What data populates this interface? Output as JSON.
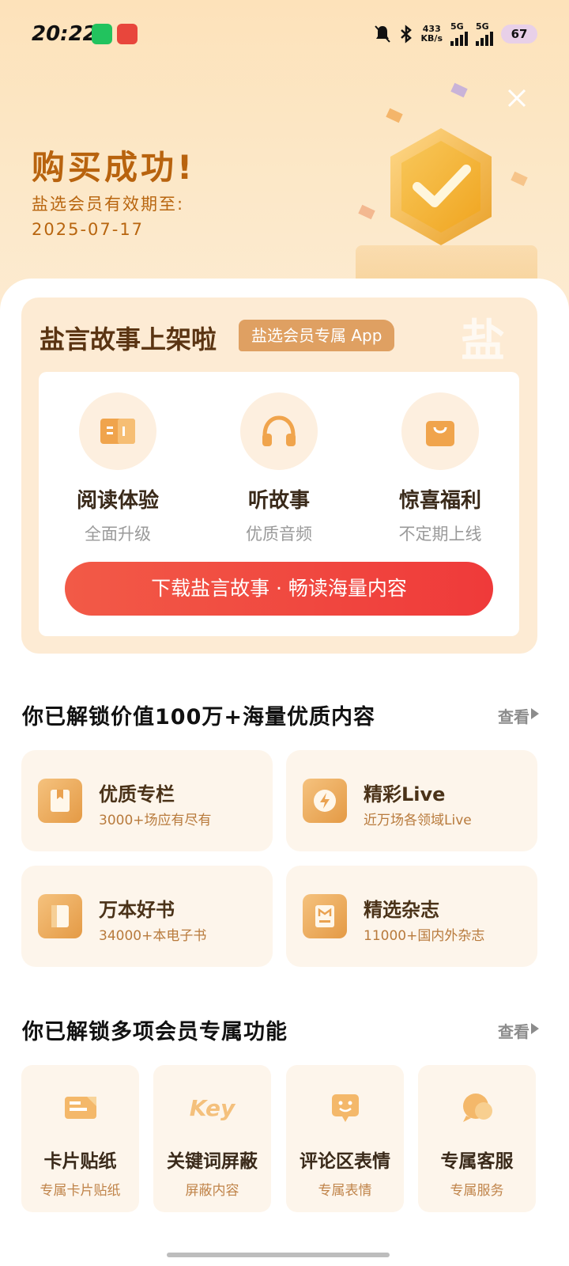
{
  "status_bar": {
    "time": "20:22",
    "net_speed_value": "433",
    "net_speed_unit": "KB/s",
    "sim1": "5G",
    "sim2": "5G",
    "battery": "67"
  },
  "hero": {
    "title": "购买成功!",
    "validity_label": "盐选会员有效期至:",
    "validity_date": "2025-07-17"
  },
  "promo": {
    "title": "盐言故事上架啦",
    "tag": "盐选会员专属 App",
    "watermark": "盐",
    "features": [
      {
        "title": "阅读体验",
        "subtitle": "全面升级",
        "icon": "book-icon"
      },
      {
        "title": "听故事",
        "subtitle": "优质音频",
        "icon": "headphones-icon"
      },
      {
        "title": "惊喜福利",
        "subtitle": "不定期上线",
        "icon": "shopping-bag-icon"
      }
    ],
    "download_button": "下载盐言故事 · 畅读海量内容"
  },
  "content_section": {
    "title": "你已解锁价值100万+海量优质内容",
    "more": "查看",
    "cards": [
      {
        "title": "优质专栏",
        "subtitle": "3000+场应有尽有",
        "icon": "column-book-icon"
      },
      {
        "title": "精彩Live",
        "subtitle": "近万场各领域Live",
        "icon": "lightning-icon"
      },
      {
        "title": "万本好书",
        "subtitle": "34000+本电子书",
        "icon": "ebook-icon"
      },
      {
        "title": "精选杂志",
        "subtitle": "11000+国内外杂志",
        "icon": "magazine-icon"
      }
    ]
  },
  "features_section": {
    "title": "你已解锁多项会员专属功能",
    "more": "查看",
    "items": [
      {
        "title": "卡片贴纸",
        "subtitle": "专属卡片贴纸",
        "icon": "card-sticker-icon"
      },
      {
        "title": "关键词屏蔽",
        "subtitle": "屏蔽内容",
        "icon": "key-icon",
        "icon_text": "Key"
      },
      {
        "title": "评论区表情",
        "subtitle": "专属表情",
        "icon": "smiley-icon"
      },
      {
        "title": "专属客服",
        "subtitle": "专属服务",
        "icon": "chat-bubble-icon"
      }
    ]
  },
  "colors": {
    "accent": "#b8630e",
    "button": "#ef3a3a",
    "card_bg": "#fdf5eb"
  }
}
